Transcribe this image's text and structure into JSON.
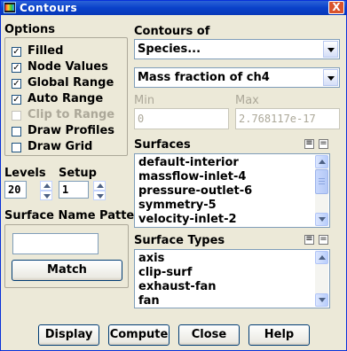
{
  "window": {
    "title": "Contours",
    "close_glyph": "X",
    "icon": "fluent-app-icon"
  },
  "options": {
    "heading": "Options",
    "checkboxes": [
      {
        "label": "Filled",
        "checked": true,
        "enabled": true
      },
      {
        "label": "Node Values",
        "checked": true,
        "enabled": true
      },
      {
        "label": "Global Range",
        "checked": true,
        "enabled": true
      },
      {
        "label": "Auto Range",
        "checked": true,
        "enabled": true
      },
      {
        "label": "Clip to Range",
        "checked": false,
        "enabled": false
      },
      {
        "label": "Draw Profiles",
        "checked": false,
        "enabled": true
      },
      {
        "label": "Draw Grid",
        "checked": false,
        "enabled": true
      }
    ],
    "check_glyph": "✓"
  },
  "levels": {
    "label": "Levels",
    "value": "20"
  },
  "setup": {
    "label": "Setup",
    "value": "1"
  },
  "surface_name_pattern": {
    "label": "Surface Name Pattern",
    "value": "",
    "match_label": "Match"
  },
  "contours_of": {
    "label": "Contours of",
    "category": "Species...",
    "quantity": "Mass fraction of ch4"
  },
  "min": {
    "label": "Min",
    "value": "0"
  },
  "max": {
    "label": "Max",
    "value": "2.768117e-17"
  },
  "surfaces": {
    "label": "Surfaces",
    "items": [
      "default-interior",
      "massflow-inlet-4",
      "pressure-outlet-6",
      "symmetry-5",
      "velocity-inlet-2"
    ]
  },
  "surface_types": {
    "label": "Surface Types",
    "items": [
      "axis",
      "clip-surf",
      "exhaust-fan",
      "fan"
    ]
  },
  "list_buttons": {
    "select_all": "≡",
    "deselect_all": "="
  },
  "buttons": {
    "display": "Display",
    "compute": "Compute",
    "close": "Close",
    "help": "Help"
  }
}
